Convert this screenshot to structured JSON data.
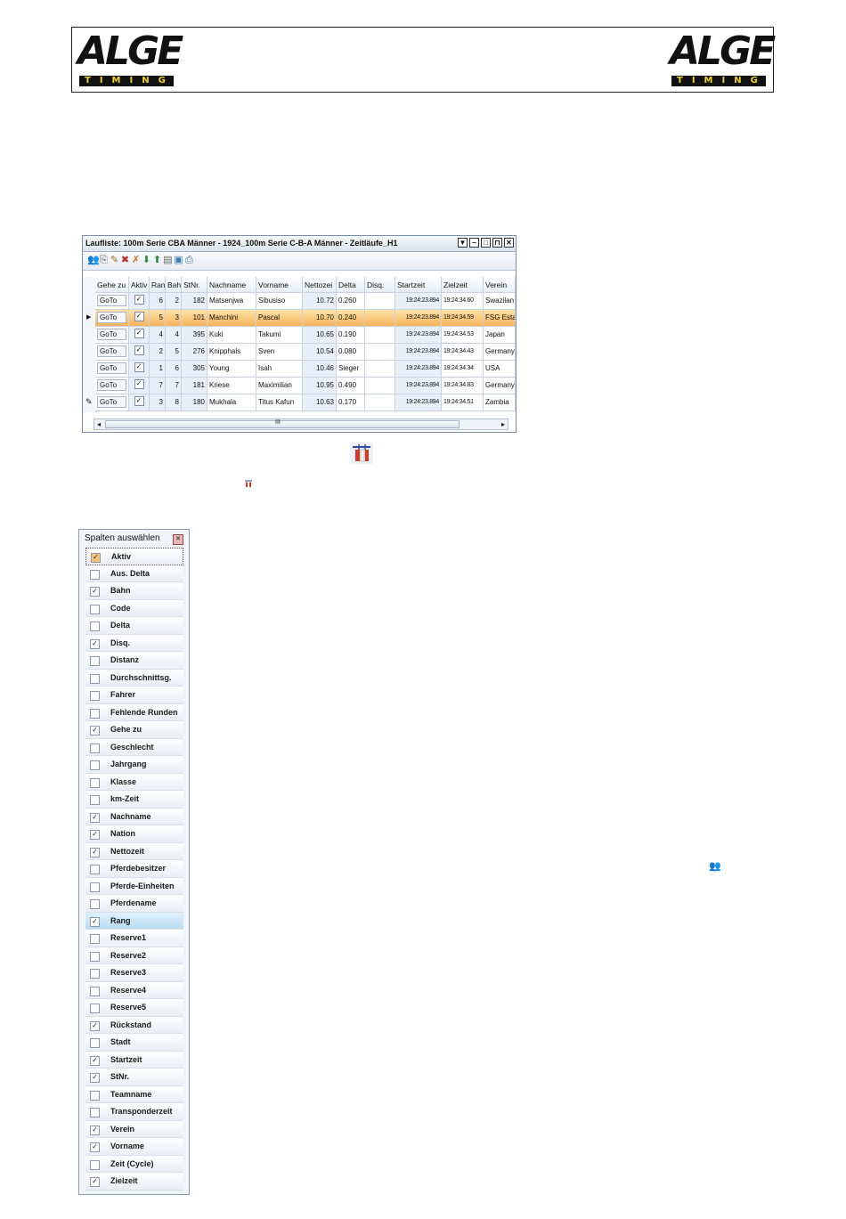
{
  "header": {
    "logo_word": "ALGE",
    "logo_sub": "TIMING"
  },
  "window": {
    "title": "Laufliste: 100m Serie CBA Männer - 1924_100m Serie C-B-A Männer - Zeitläufe_H1",
    "buttons": [
      "▼",
      "‒",
      "□",
      "⊓",
      "✕"
    ],
    "toolbar_icons": [
      "users-icon",
      "export-icon",
      "edit-icon",
      "delete-icon",
      "disqualify-icon",
      "download-icon",
      "upload-icon",
      "report-icon",
      "view-icon",
      "print-icon"
    ],
    "columns": [
      "Gehe zu",
      "Aktiv",
      "Ran",
      "Bah",
      "StNr.",
      "Nachname",
      "Vorname",
      "Nettozei",
      "Delta",
      "Disq.",
      "Startzeit",
      "Zielzeit",
      "Verein"
    ],
    "rows": [
      {
        "goto": "GoTo",
        "aktiv": "✓",
        "rang": "6",
        "bahn": "2",
        "stnr": "182",
        "nachname": "Matsenjwa",
        "vorname": "Sibusiso",
        "netto": "10.72",
        "delta": "0.260",
        "disq": "",
        "start": "19:24:23.894",
        "ziel": "19:24:34.60",
        "verein": "Swazilan"
      },
      {
        "goto": "GoTo",
        "aktiv": "✓",
        "rang": "5",
        "bahn": "3",
        "stnr": "101",
        "nachname": "Manchini",
        "vorname": "Pascal",
        "netto": "10.70",
        "delta": "0.240",
        "disq": "",
        "start": "19:24:23.894",
        "ziel": "19:24:34.59",
        "verein": "FSG Esta"
      },
      {
        "goto": "GoTo",
        "aktiv": "✓",
        "rang": "4",
        "bahn": "4",
        "stnr": "395",
        "nachname": "Kuki",
        "vorname": "Takumi",
        "netto": "10.65",
        "delta": "0.190",
        "disq": "",
        "start": "19:24:23.894",
        "ziel": "19:24:34.53",
        "verein": "Japan"
      },
      {
        "goto": "GoTo",
        "aktiv": "✓",
        "rang": "2",
        "bahn": "5",
        "stnr": "276",
        "nachname": "Knipphals",
        "vorname": "Sven",
        "netto": "10.54",
        "delta": "0.080",
        "disq": "",
        "start": "19:24:23.894",
        "ziel": "19:24:34.43",
        "verein": "Germany"
      },
      {
        "goto": "GoTo",
        "aktiv": "✓",
        "rang": "1",
        "bahn": "6",
        "stnr": "305",
        "nachname": "Young",
        "vorname": "Isah",
        "netto": "10.46",
        "delta": "Sieger",
        "disq": "",
        "start": "19:24:23.894",
        "ziel": "19:24:34.34",
        "verein": "USA"
      },
      {
        "goto": "GoTo",
        "aktiv": "✓",
        "rang": "7",
        "bahn": "7",
        "stnr": "181",
        "nachname": "Kriese",
        "vorname": "Maximilian",
        "netto": "10.95",
        "delta": "0.490",
        "disq": "",
        "start": "19:24:23.894",
        "ziel": "19:24:34.83",
        "verein": "Germany"
      },
      {
        "goto": "GoTo",
        "aktiv": "✓",
        "rang": "3",
        "bahn": "8",
        "stnr": "180",
        "nachname": "Mukhala",
        "vorname": "Titus Kafun",
        "netto": "10.63",
        "delta": "0.170",
        "disq": "",
        "start": "19:24:23.894",
        "ziel": "19:24:34.51",
        "verein": "Zambia"
      }
    ],
    "selected_row": 1,
    "scroll_label": "III"
  },
  "column_chooser": {
    "title": "Spalten auswählen",
    "close": "✕",
    "items": [
      {
        "label": "Aktiv",
        "checked": true
      },
      {
        "label": "Aus. Delta",
        "checked": false
      },
      {
        "label": "Bahn",
        "checked": true
      },
      {
        "label": "Code",
        "checked": false
      },
      {
        "label": "Delta",
        "checked": false
      },
      {
        "label": "Disq.",
        "checked": true
      },
      {
        "label": "Distanz",
        "checked": false
      },
      {
        "label": "Durchschnittsg.",
        "checked": false
      },
      {
        "label": "Fahrer",
        "checked": false
      },
      {
        "label": "Fehlende Runden",
        "checked": false
      },
      {
        "label": "Gehe zu",
        "checked": true
      },
      {
        "label": "Geschlecht",
        "checked": false
      },
      {
        "label": "Jahrgang",
        "checked": false
      },
      {
        "label": "Klasse",
        "checked": false
      },
      {
        "label": "km-Zeit",
        "checked": false
      },
      {
        "label": "Nachname",
        "checked": true
      },
      {
        "label": "Nation",
        "checked": true
      },
      {
        "label": "Nettozeit",
        "checked": true
      },
      {
        "label": "Pferdebesitzer",
        "checked": false
      },
      {
        "label": "Pferde-Einheiten",
        "checked": false
      },
      {
        "label": "Pferdename",
        "checked": false
      },
      {
        "label": "Rang",
        "checked": true
      },
      {
        "label": "Reserve1",
        "checked": false
      },
      {
        "label": "Reserve2",
        "checked": false
      },
      {
        "label": "Reserve3",
        "checked": false
      },
      {
        "label": "Reserve4",
        "checked": false
      },
      {
        "label": "Reserve5",
        "checked": false
      },
      {
        "label": "Rückstand",
        "checked": true
      },
      {
        "label": "Stadt",
        "checked": false
      },
      {
        "label": "Startzeit",
        "checked": true
      },
      {
        "label": "StNr.",
        "checked": true
      },
      {
        "label": "Teamname",
        "checked": false
      },
      {
        "label": "Transponderzeit",
        "checked": false
      },
      {
        "label": "Verein",
        "checked": true
      },
      {
        "label": "Vorname",
        "checked": true
      },
      {
        "label": "Zeit (Cycle)",
        "checked": false
      },
      {
        "label": "Zielzeit",
        "checked": true
      }
    ],
    "highlight_index": 21
  }
}
